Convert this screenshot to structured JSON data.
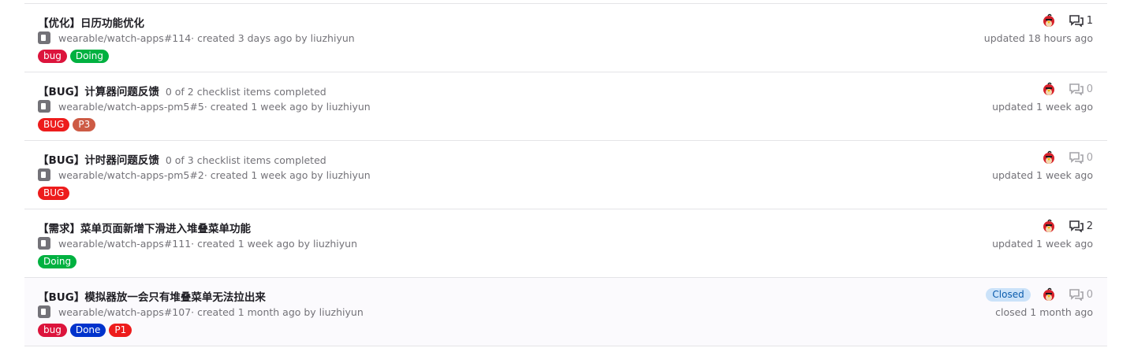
{
  "issues": [
    {
      "title": "【优化】日历功能优化",
      "checklist": "",
      "ref": "wearable/watch-apps#114",
      "created": " · created 3 days ago by liuzhiyun",
      "labels": [
        {
          "text": "bug",
          "color": "#dc143c"
        },
        {
          "text": "Doing",
          "color": "#00b140"
        }
      ],
      "comments": "1",
      "status": "",
      "updated": "updated 18 hours ago"
    },
    {
      "title": "【BUG】计算器问题反馈",
      "checklist": "0 of 2 checklist items completed",
      "ref": "wearable/watch-apps-pm5#5",
      "created": " · created 1 week ago by liuzhiyun",
      "labels": [
        {
          "text": "BUG",
          "color": "#ed1c1c"
        },
        {
          "text": "P3",
          "color": "#cd5b45"
        }
      ],
      "comments": "0",
      "status": "",
      "updated": "updated 1 week ago"
    },
    {
      "title": "【BUG】计时器问题反馈",
      "checklist": "0 of 3 checklist items completed",
      "ref": "wearable/watch-apps-pm5#2",
      "created": " · created 1 week ago by liuzhiyun",
      "labels": [
        {
          "text": "BUG",
          "color": "#ed1c1c"
        }
      ],
      "comments": "0",
      "status": "",
      "updated": "updated 1 week ago"
    },
    {
      "title": "【需求】菜单页面新增下滑进入堆叠菜单功能",
      "checklist": "",
      "ref": "wearable/watch-apps#111",
      "created": " · created 1 week ago by liuzhiyun",
      "labels": [
        {
          "text": "Doing",
          "color": "#00b140"
        }
      ],
      "comments": "2",
      "status": "",
      "updated": "updated 1 week ago"
    },
    {
      "title": "【BUG】模拟器放一会只有堆叠菜单无法拉出来",
      "checklist": "",
      "ref": "wearable/watch-apps#107",
      "created": " · created 1 month ago by liuzhiyun",
      "labels": [
        {
          "text": "bug",
          "color": "#dc143c"
        },
        {
          "text": "Done",
          "color": "#0033cc"
        },
        {
          "text": "P1",
          "color": "#ed1c1c"
        }
      ],
      "comments": "0",
      "status": "Closed",
      "updated": "closed 1 month ago"
    }
  ]
}
